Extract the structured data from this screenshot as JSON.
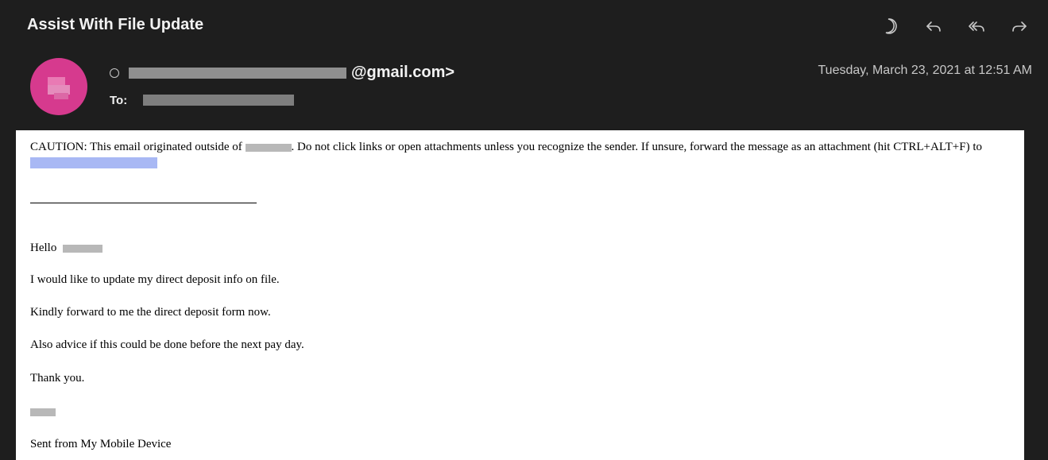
{
  "header": {
    "subject": "Assist With File Update",
    "from_suffix": "@gmail.com>",
    "to_label": "To:",
    "date": "Tuesday, March 23, 2021 at 12:51 AM",
    "toolbar": [
      "moon-icon",
      "reply-icon",
      "reply-all-icon",
      "forward-icon"
    ]
  },
  "body": {
    "caution_part1": "CAUTION: This email originated outside of",
    "caution_part2": ". Do not click links or open attachments unless you recognize the sender. If unsure, forward the message as an attachment (hit CTRL+ALT+F) to",
    "greeting": "Hello",
    "line1": " I would like to update my direct deposit info on file.",
    "line2": "Kindly forward to me the direct deposit form now.",
    "line3": "Also advice if this could be done before the next pay day.",
    "line4": "Thank you.",
    "signature": "Sent from My Mobile Device"
  },
  "colors": {
    "header_bg": "#1e1e1e",
    "avatar": "#d63a8e",
    "link_redaction": "#a8b8f4"
  }
}
